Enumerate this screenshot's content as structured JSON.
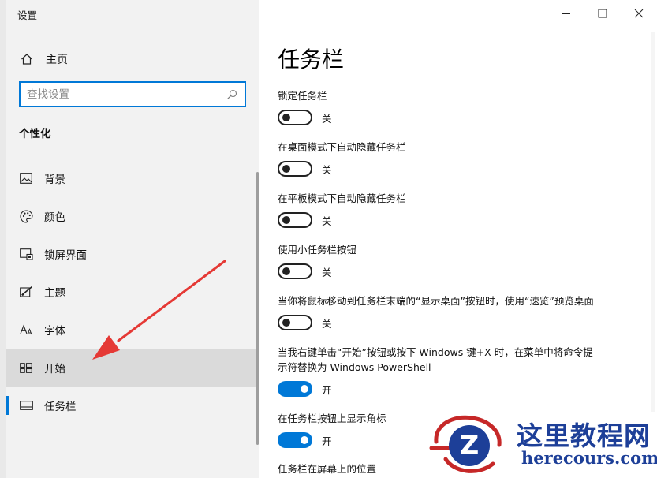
{
  "window": {
    "title": "设置"
  },
  "sidebar": {
    "home_label": "主页",
    "search_placeholder": "查找设置",
    "section_title": "个性化",
    "items": [
      {
        "label": "背景",
        "icon": "image-icon"
      },
      {
        "label": "颜色",
        "icon": "palette-icon"
      },
      {
        "label": "锁屏界面",
        "icon": "lock-screen-icon"
      },
      {
        "label": "主题",
        "icon": "theme-brush-icon"
      },
      {
        "label": "字体",
        "icon": "font-icon"
      },
      {
        "label": "开始",
        "icon": "start-grid-icon",
        "state": "hovered"
      },
      {
        "label": "任务栏",
        "icon": "taskbar-icon",
        "state": "selected"
      }
    ]
  },
  "main": {
    "title": "任务栏",
    "settings": [
      {
        "label": "锁定任务栏",
        "on": false,
        "state_text": "关"
      },
      {
        "label": "在桌面模式下自动隐藏任务栏",
        "on": false,
        "state_text": "关"
      },
      {
        "label": "在平板模式下自动隐藏任务栏",
        "on": false,
        "state_text": "关"
      },
      {
        "label": "使用小任务栏按钮",
        "on": false,
        "state_text": "关"
      },
      {
        "label": "当你将鼠标移动到任务栏末端的“显示桌面”按钮时，使用“速览”预览桌面",
        "on": false,
        "state_text": "关"
      },
      {
        "label_lines": [
          "当我右键单击“开始”按钮或按下 Windows 键+X 时，在菜单中将命令提",
          "示符替换为 Windows PowerShell"
        ],
        "on": true,
        "state_text": "开"
      },
      {
        "label": "在任务栏按钮上显示角标",
        "on": true,
        "state_text": "开"
      }
    ],
    "partial_label": "任务栏在屏幕上的位置"
  },
  "colors": {
    "accent": "#0078d7",
    "arrow": "#e53935",
    "watermark": "#1d3f98"
  },
  "watermark": {
    "cn": "这里教程网",
    "en": "herecours.com",
    "logo_letter": "Z"
  }
}
